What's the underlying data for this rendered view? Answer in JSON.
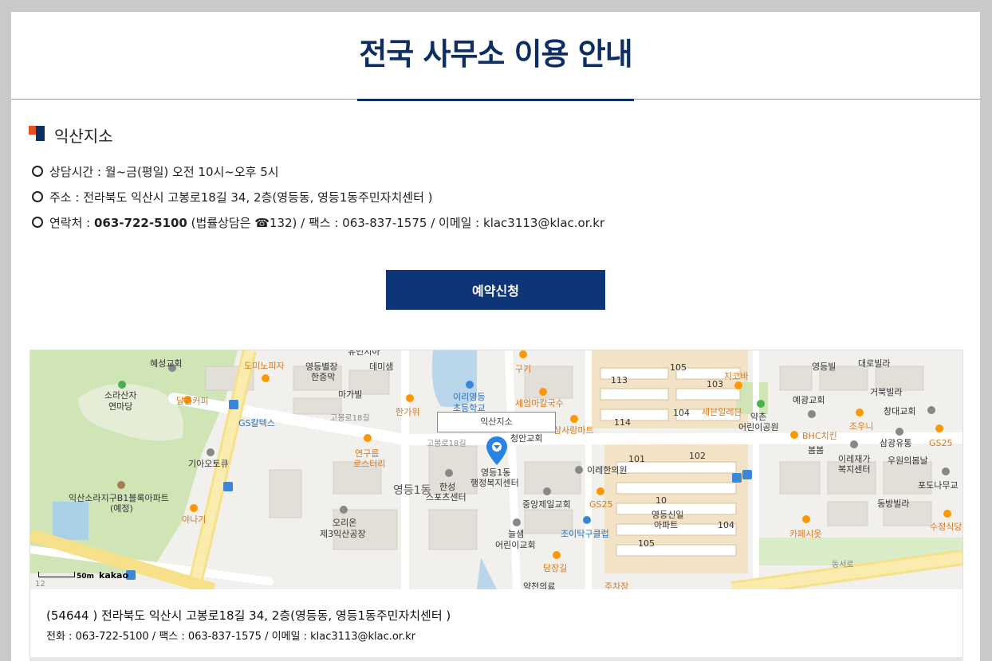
{
  "page": {
    "title": "전국 사무소 이용 안내"
  },
  "office": {
    "name": "익산지소",
    "hours": "상담시간 : 월~금(평일) 오전 10시~오후 5시",
    "address": "주소 : 전라북도 익산시 고봉로18길 34, 2층(영등동, 영등1동주민자치센터 )",
    "contact_prefix": "연락처 : ",
    "phone": "063-722-5100",
    "contact_mid": " (법률상담은 ☎132) / 팩스 : 063-837-1575 / 이메일 : klac3113@klac.or.kr"
  },
  "reserve_button": {
    "label": "예약신청"
  },
  "map": {
    "pin_label": "익산지소",
    "scale_label": "50m",
    "logo": "kakao",
    "labels": {
      "hyeseong": "혜성교회",
      "dominos": "도미노피자",
      "youngdeung_byeoljang": "영등별장",
      "hanjeungmak": "한증막",
      "demisaem": "데미샘",
      "magabil": "마가빌",
      "sorasanja": "소라산자",
      "yeonmadang": "연마당",
      "dalkom": "달콤커피",
      "gs_caltex": "GS칼텍스",
      "gobongro18": "고봉로18길",
      "gobongro18b": "고봉로18길",
      "hangawi": "한가위",
      "iri_youngdeung": "이리영등",
      "elementary": "초등학교",
      "gugi": "구기",
      "seeop": "세엄마칼국수",
      "samsarang": "삼사랑마트",
      "cheongan": "청안교회",
      "ieun": "이레한의원",
      "jicoba": "지코바",
      "seboon": "세븐일레븐",
      "yakchon": "약촌",
      "eorini_park": "어린이공원",
      "yeongdeungbil": "영등빌",
      "daerobilla": "대로빌라",
      "yegwang": "예광교회",
      "geobukbilla": "거북빌라",
      "changdae": "창대교회",
      "joni": "조우니",
      "bhc": "BHC치킨",
      "bombom": "봄봄",
      "samgwang": "삼광유통",
      "gs25_right": "GS25",
      "irejaega": "이레재가",
      "bokji": "복지센터",
      "uwon": "우원의봄날",
      "podonamu": "포도나무교",
      "dongbang": "동방빌라",
      "sujeong": "수정식당",
      "cafe_siot": "카페시옷",
      "kia": "기아오토큐",
      "iksan_sora": "익산소라지구B1블록아파트",
      "yejeong": "(예정)",
      "ganagi": "야나기",
      "yeonguleum": "연구름",
      "roseuteori": "로스터리",
      "youngdeung1dong": "영등1동",
      "hanseong": "한성",
      "sports": "스포츠센터",
      "orion": "오리온",
      "orion_factory": "제3익산공장",
      "pin_top": "영등1동",
      "pin_bottom": "행정복지센터",
      "jungang": "중앙제일교회",
      "gs25_mid": "GS25",
      "joitak": "조이탁구클럽",
      "neulsaem": "늘샘",
      "neulsaem2": "어린이교회",
      "damjang": "담장길",
      "youngdeung_sinil": "영등신일",
      "apartment": "아파트",
      "dongseoro": "동서로",
      "yuninja": "유민지아",
      "num_105a": "105",
      "num_113": "113",
      "num_103": "103",
      "num_114": "114",
      "num_104a": "104",
      "num_101": "101",
      "num_102": "102",
      "num_10x": "10",
      "num_105b": "105",
      "num_104b": "104",
      "num_12": "12",
      "jujang": "주차장",
      "jian": "약천의료"
    }
  },
  "address_box": {
    "address": "(54644 ) 전라북도 익산시 고봉로18길 34, 2층(영등동, 영등1동주민자치센터 )",
    "contact": "전화 : 063-722-5100 / 팩스 : 063-837-1575 / 이메일 : klac3113@klac.or.kr"
  },
  "colors": {
    "brand_navy": "#0d2e63",
    "button_navy": "#0d3577",
    "accent_orange": "#e8501f"
  }
}
